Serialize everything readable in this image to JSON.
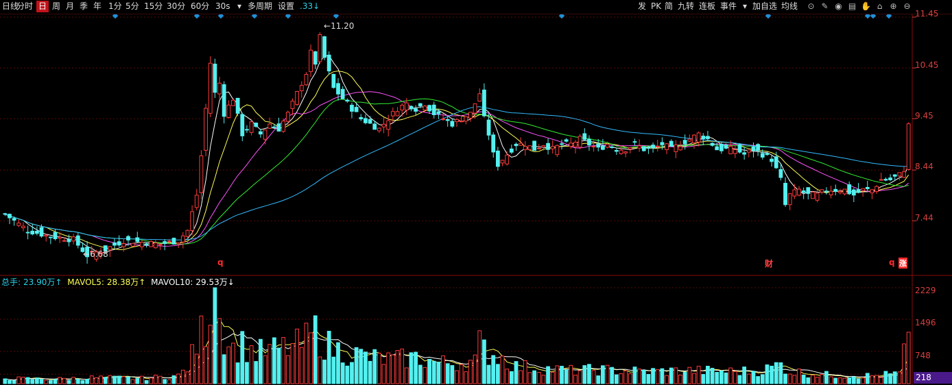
{
  "toolbar": {
    "left": [
      {
        "label": "日线",
        "key": "day_line"
      },
      {
        "label": "分时",
        "key": "intraday"
      },
      {
        "label": "日",
        "key": "day",
        "active": true
      },
      {
        "label": "周",
        "key": "week"
      },
      {
        "label": "月",
        "key": "month"
      },
      {
        "label": "季",
        "key": "quarter"
      },
      {
        "label": "年",
        "key": "year"
      },
      {
        "label": "1分",
        "key": "m1"
      },
      {
        "label": "5分",
        "key": "m5"
      },
      {
        "label": "15分",
        "key": "m15"
      },
      {
        "label": "30分",
        "key": "m30"
      },
      {
        "label": "60分",
        "key": "m60"
      },
      {
        "label": "30s",
        "key": "s30"
      },
      {
        "label": "▾",
        "key": "period_dropdown"
      },
      {
        "label": "多周期",
        "key": "multi_period"
      },
      {
        "label": "设置",
        "key": "settings"
      },
      {
        "label": ".33↓",
        "key": "indicator_value"
      }
    ],
    "right": [
      {
        "label": "发",
        "key": "fa"
      },
      {
        "label": "PK",
        "key": "pk"
      },
      {
        "label": "简",
        "key": "jian"
      },
      {
        "label": "九转",
        "key": "jiuzhuan"
      },
      {
        "label": "连板",
        "key": "lianban"
      },
      {
        "label": "事件",
        "key": "event"
      },
      {
        "label": "▾",
        "key": "more_dropdown"
      },
      {
        "label": "加自选",
        "key": "add_watch"
      },
      {
        "label": "均线",
        "key": "ma_lines"
      }
    ],
    "icons": [
      "target-icon",
      "pen-icon",
      "eye-icon",
      "calendar-icon",
      "hand-icon",
      "home-icon",
      "zoom-in-icon",
      "zoom-out-icon"
    ]
  },
  "colors": {
    "up": "#ff3b3b",
    "down": "#54f0f0",
    "ma5": "#ffffff",
    "ma10": "#ffff55",
    "ma20": "#ff55ff",
    "ma30": "#33ee33",
    "ma60": "#33bbff",
    "vol_ma5": "#ffff55",
    "vol_ma10": "#ffffff",
    "axis_text": "#d84040",
    "grid": "#5a0a0a",
    "divider": "#8a0a0a"
  },
  "chart_data": {
    "type": "candlestick",
    "price_axis": {
      "ticks": [
        "11.45",
        "10.45",
        "9.45",
        "8.44",
        "7.44"
      ],
      "ylim": [
        6.42,
        11.49
      ]
    },
    "volume_axis": {
      "ticks": [
        "2229",
        "1496",
        "748",
        "218"
      ],
      "ylim": [
        0,
        2229
      ]
    },
    "annotations": {
      "high": "11.20",
      "low": "6.68",
      "markers": [
        "q",
        "q",
        "财",
        "q",
        "涨"
      ]
    },
    "volume_header": {
      "total_label": "总手:",
      "total_value": "23.90万↑",
      "mavol5_label": "MAVOL5:",
      "mavol5_value": "28.38万↑",
      "mavol10_label": "MAVOL10:",
      "mavol10_value": "29.53万↓"
    },
    "current_volume": "218",
    "ohlc_keypoints": [
      [
        0,
        7.57
      ],
      [
        5,
        7.25
      ],
      [
        10,
        7.13
      ],
      [
        15,
        7.07
      ],
      [
        18,
        6.76
      ],
      [
        22,
        6.88
      ],
      [
        26,
        7.05
      ],
      [
        30,
        7.02
      ],
      [
        34,
        6.98
      ],
      [
        38,
        7.05
      ],
      [
        40,
        7.25
      ],
      [
        42,
        7.95
      ],
      [
        43,
        8.72
      ],
      [
        44,
        9.65
      ],
      [
        45,
        10.55
      ],
      [
        46,
        9.95
      ],
      [
        47,
        10.15
      ],
      [
        48,
        9.55
      ],
      [
        50,
        9.85
      ],
      [
        52,
        9.15
      ],
      [
        54,
        9.35
      ],
      [
        56,
        9.15
      ],
      [
        58,
        9.35
      ],
      [
        60,
        9.25
      ],
      [
        62,
        9.55
      ],
      [
        64,
        9.95
      ],
      [
        66,
        10.35
      ],
      [
        67,
        10.75
      ],
      [
        68,
        10.55
      ],
      [
        69,
        11.05
      ],
      [
        70,
        10.65
      ],
      [
        71,
        10.35
      ],
      [
        72,
        10.05
      ],
      [
        74,
        9.85
      ],
      [
        76,
        9.65
      ],
      [
        78,
        9.45
      ],
      [
        80,
        9.35
      ],
      [
        82,
        9.25
      ],
      [
        84,
        9.45
      ],
      [
        86,
        9.65
      ],
      [
        88,
        9.75
      ],
      [
        90,
        9.65
      ],
      [
        92,
        9.75
      ],
      [
        94,
        9.55
      ],
      [
        96,
        9.45
      ],
      [
        98,
        9.35
      ],
      [
        100,
        9.45
      ],
      [
        102,
        9.55
      ],
      [
        104,
        9.95
      ],
      [
        105,
        9.45
      ],
      [
        106,
        9.15
      ],
      [
        107,
        8.75
      ],
      [
        108,
        8.55
      ],
      [
        110,
        8.75
      ],
      [
        112,
        8.95
      ],
      [
        114,
        8.95
      ],
      [
        116,
        8.85
      ],
      [
        118,
        8.95
      ],
      [
        120,
        8.85
      ],
      [
        122,
        8.95
      ],
      [
        124,
        8.95
      ],
      [
        126,
        9.05
      ],
      [
        128,
        8.95
      ],
      [
        130,
        8.85
      ],
      [
        132,
        8.95
      ],
      [
        134,
        8.85
      ],
      [
        136,
        8.85
      ],
      [
        138,
        8.95
      ],
      [
        140,
        8.85
      ],
      [
        142,
        8.85
      ],
      [
        144,
        8.95
      ],
      [
        146,
        8.85
      ],
      [
        148,
        8.95
      ],
      [
        150,
        9.05
      ],
      [
        152,
        9.15
      ],
      [
        154,
        9.05
      ],
      [
        156,
        8.85
      ],
      [
        158,
        8.85
      ],
      [
        160,
        8.85
      ],
      [
        162,
        8.75
      ],
      [
        164,
        8.85
      ],
      [
        166,
        8.75
      ],
      [
        168,
        8.65
      ],
      [
        170,
        8.25
      ],
      [
        171,
        7.75
      ],
      [
        172,
        7.95
      ],
      [
        174,
        8.05
      ],
      [
        176,
        7.95
      ],
      [
        178,
        7.95
      ],
      [
        180,
        8.05
      ],
      [
        182,
        8.05
      ],
      [
        184,
        8.05
      ],
      [
        186,
        7.95
      ],
      [
        188,
        8.05
      ],
      [
        190,
        8.05
      ],
      [
        192,
        8.25
      ],
      [
        194,
        8.25
      ],
      [
        196,
        8.35
      ],
      [
        197,
        8.45
      ],
      [
        198,
        9.35
      ]
    ],
    "volume_keypoints": [
      [
        0,
        120
      ],
      [
        10,
        100
      ],
      [
        20,
        140
      ],
      [
        30,
        120
      ],
      [
        38,
        180
      ],
      [
        40,
        380
      ],
      [
        42,
        900
      ],
      [
        44,
        1400
      ],
      [
        46,
        2229
      ],
      [
        47,
        1500
      ],
      [
        48,
        1200
      ],
      [
        50,
        800
      ],
      [
        52,
        900
      ],
      [
        55,
        700
      ],
      [
        60,
        800
      ],
      [
        65,
        900
      ],
      [
        68,
        1200
      ],
      [
        70,
        950
      ],
      [
        72,
        800
      ],
      [
        76,
        700
      ],
      [
        80,
        600
      ],
      [
        85,
        550
      ],
      [
        90,
        600
      ],
      [
        95,
        480
      ],
      [
        100,
        480
      ],
      [
        103,
        520
      ],
      [
        104,
        900
      ],
      [
        106,
        700
      ],
      [
        108,
        650
      ],
      [
        112,
        400
      ],
      [
        118,
        350
      ],
      [
        124,
        300
      ],
      [
        130,
        320
      ],
      [
        140,
        280
      ],
      [
        150,
        300
      ],
      [
        160,
        280
      ],
      [
        166,
        300
      ],
      [
        170,
        450
      ],
      [
        172,
        280
      ],
      [
        180,
        200
      ],
      [
        190,
        180
      ],
      [
        196,
        230
      ],
      [
        198,
        1196
      ]
    ]
  }
}
